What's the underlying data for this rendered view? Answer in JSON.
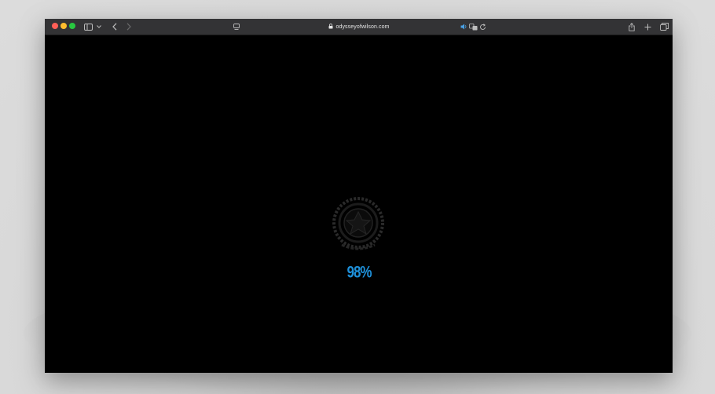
{
  "browser": {
    "url": "odysseyofwilson.com",
    "traffic_lights": {
      "close": "#ff5f57",
      "minimize": "#febc2e",
      "maximize": "#28c840"
    },
    "icons": {
      "sidebar": "sidebar-icon",
      "back": "chevron-left-icon",
      "forward": "chevron-right-icon",
      "reader": "reader-icon",
      "lock": "lock-icon",
      "audio": "speaker-icon",
      "translate": "translate-icon",
      "reload": "reload-icon",
      "share": "share-icon",
      "new_tab": "plus-icon",
      "tabs": "tab-overview-icon"
    }
  },
  "page": {
    "background": "#000000",
    "loader": {
      "percent_text": "98%",
      "progress": 98,
      "accent": "#1e8fd8"
    }
  }
}
